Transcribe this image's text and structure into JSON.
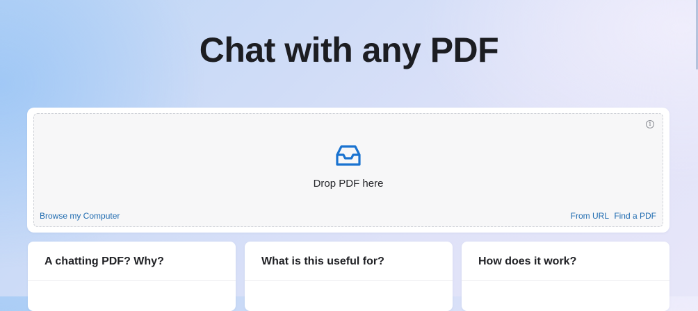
{
  "header": {
    "title": "Chat with any PDF"
  },
  "upload": {
    "drop_label": "Drop PDF here",
    "drop_icon": "inbox-icon",
    "info_icon": "info-icon",
    "info_glyph": "i",
    "browse_label": "Browse my Computer",
    "from_url_label": "From URL",
    "find_pdf_label": "Find a PDF",
    "accent_color": "#1a73d0"
  },
  "cards": [
    {
      "title": "A chatting PDF? Why?"
    },
    {
      "title": "What is this useful for?"
    },
    {
      "title": "How does it work?"
    }
  ]
}
